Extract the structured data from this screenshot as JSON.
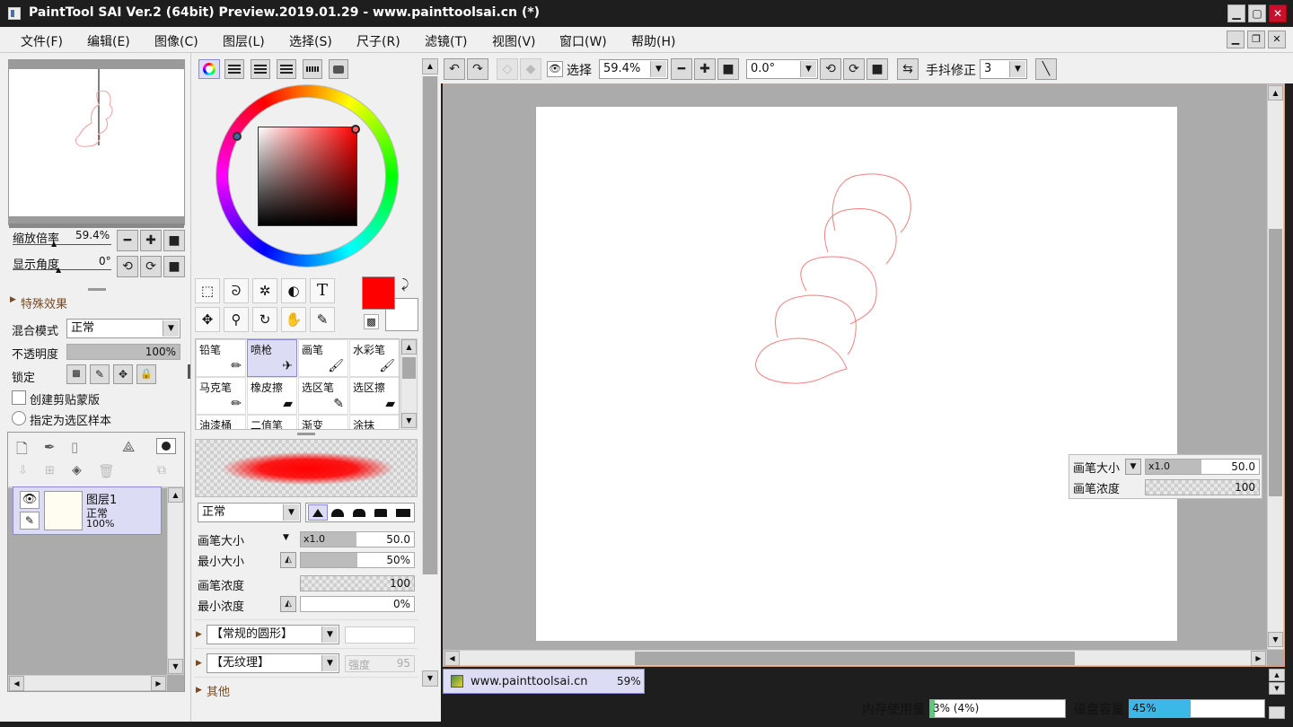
{
  "window": {
    "title": "PaintTool SAI Ver.2 (64bit) Preview.2019.01.29 - www.painttoolsai.cn (*)"
  },
  "menu": [
    "文件(F)",
    "编辑(E)",
    "图像(C)",
    "图层(L)",
    "选择(S)",
    "尺子(R)",
    "滤镜(T)",
    "视图(V)",
    "窗口(W)",
    "帮助(H)"
  ],
  "navigator": {
    "zoom_label": "缩放倍率",
    "zoom_value": "59.4%",
    "angle_label": "显示角度",
    "angle_value": "0°"
  },
  "layer_panel": {
    "section_title": "特殊效果",
    "blend_label": "混合模式",
    "blend_value": "正常",
    "opacity_label": "不透明度",
    "opacity_value": "100%",
    "lock_label": "锁定",
    "clip_label": "创建剪贴蒙版",
    "sample_label": "指定为选区样本",
    "layers": [
      {
        "name": "图层1",
        "mode": "正常",
        "opacity": "100%"
      }
    ]
  },
  "colors": {
    "primary": "#ff0000",
    "secondary": "#ffffff",
    "accent": "#5a5ad8"
  },
  "tools": {
    "row1": [
      {
        "name": "rect-select-icon",
        "glyph": "⬚"
      },
      {
        "name": "lasso-icon",
        "glyph": "ᘐ"
      },
      {
        "name": "magic-wand-icon",
        "glyph": "✲"
      },
      {
        "name": "shape-icon",
        "glyph": "◐"
      },
      {
        "name": "text-tool-icon",
        "glyph": "T"
      }
    ],
    "row2": [
      {
        "name": "move-icon",
        "glyph": "✥"
      },
      {
        "name": "zoom-icon",
        "glyph": "⚲"
      },
      {
        "name": "rotate-icon",
        "glyph": "↻"
      },
      {
        "name": "hand-icon",
        "glyph": "✋"
      },
      {
        "name": "eyedropper-icon",
        "glyph": "✎"
      }
    ]
  },
  "brushes": [
    {
      "label": "铅笔",
      "icon": "✏",
      "selected": false
    },
    {
      "label": "喷枪",
      "icon": "✈",
      "selected": true
    },
    {
      "label": "画笔",
      "icon": "🖌",
      "selected": false
    },
    {
      "label": "水彩笔",
      "icon": "🖌",
      "selected": false
    },
    {
      "label": "马克笔",
      "icon": "✏",
      "selected": false
    },
    {
      "label": "橡皮擦",
      "icon": "▰",
      "selected": false
    },
    {
      "label": "选区笔",
      "icon": "✎",
      "selected": false
    },
    {
      "label": "选区擦",
      "icon": "▰",
      "selected": false
    },
    {
      "label": "油漆桶",
      "icon": "",
      "selected": false
    },
    {
      "label": "二值笔",
      "icon": "",
      "selected": false
    },
    {
      "label": "渐变",
      "icon": "",
      "selected": false
    },
    {
      "label": "涂抹",
      "icon": "",
      "selected": false
    }
  ],
  "brush_settings": {
    "mode": "正常",
    "size_label": "画笔大小",
    "size_mul": "x1.0",
    "size_value": "50.0",
    "min_size_label": "最小大小",
    "min_size_value": "50%",
    "min_size_fill": 0.5,
    "density_label": "画笔浓度",
    "density_value": "100",
    "min_density_label": "最小浓度",
    "min_density_value": "0%",
    "shape": "【常规的圆形】",
    "texture": "【无纹理】",
    "strength_label": "强度",
    "strength_value": "95",
    "other": "其他"
  },
  "toolbar": {
    "select_label": "选择",
    "zoom_value": "59.4%",
    "angle_value": "0.0°",
    "stab_label": "手抖修正",
    "stab_value": "3"
  },
  "canvas_overlay": {
    "size_label": "画笔大小",
    "size_mul": "x1.0",
    "size_value": "50.0",
    "density_label": "画笔浓度",
    "density_value": "100"
  },
  "document_tab": {
    "name": "www.painttoolsai.cn",
    "zoom": "59%"
  },
  "status": {
    "mem_label": "内存使用量",
    "mem_value": "3% (4%)",
    "mem_fill": 0.03,
    "disk_label": "磁盘容量",
    "disk_value": "45%",
    "disk_fill": 0.45
  }
}
